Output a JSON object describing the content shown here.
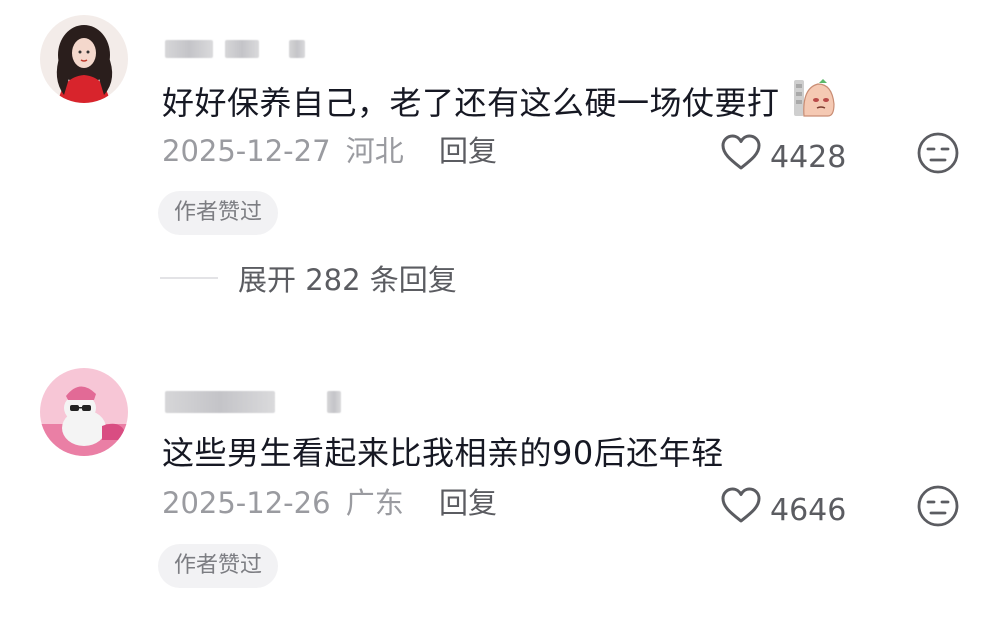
{
  "comments": [
    {
      "text": "好好保养自己，老了还有这么硬一场仗要打",
      "date": "2025-12-27",
      "region": "河北",
      "reply_label": "回复",
      "likes": "4428",
      "badge": "作者赞过",
      "sticker_icon": "sweating-potato-sticker",
      "expand_label": "展开 282 条回复"
    },
    {
      "text": "这些男生看起来比我相亲的90后还年轻",
      "date": "2025-12-26",
      "region": "广东",
      "reply_label": "回复",
      "likes": "4646",
      "badge": "作者赞过"
    }
  ],
  "icons": {
    "like": "heart-outline-icon",
    "reaction": "neutral-face-icon"
  },
  "colors": {
    "primary_text": "#161823",
    "secondary_text": "#9a9ba0",
    "action_text": "#5b5c61",
    "badge_bg": "#f2f2f4"
  }
}
